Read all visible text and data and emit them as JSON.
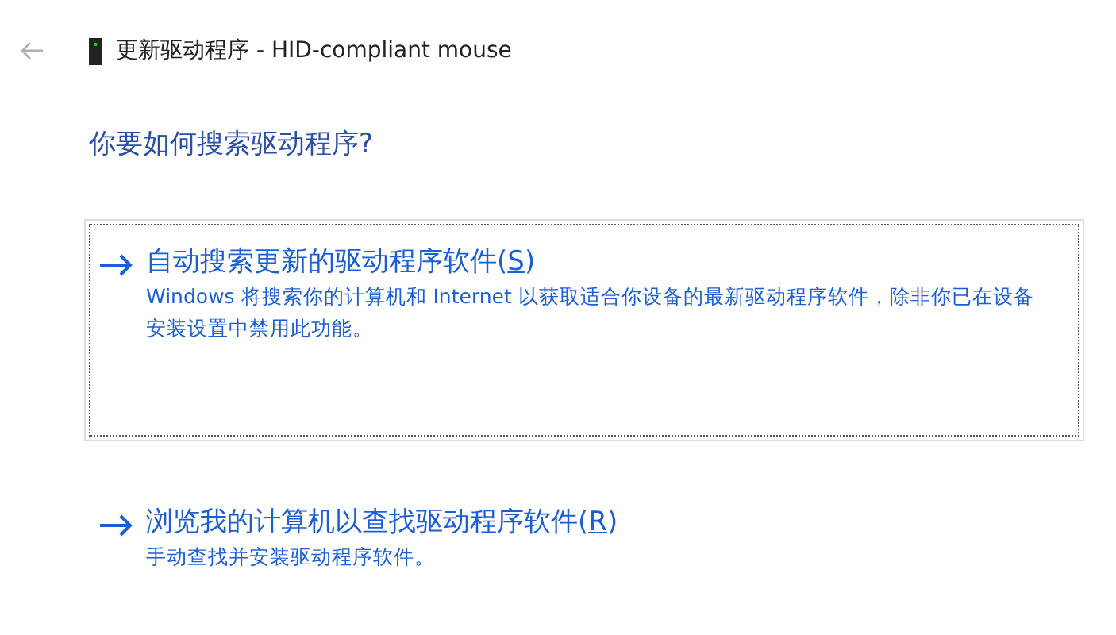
{
  "window": {
    "title": "更新驱动程序 - HID-compliant mouse"
  },
  "heading": "你要如何搜索驱动程序?",
  "options": [
    {
      "title": "自动搜索更新的驱动程序软件(",
      "access_key": "S",
      "title_end": ")",
      "description": "Windows 将搜索你的计算机和 Internet 以获取适合你设备的最新驱动程序软件，除非你已在设备安装设置中禁用此功能。",
      "focused": true
    },
    {
      "title": "浏览我的计算机以查找驱动程序软件(",
      "access_key": "R",
      "title_end": ")",
      "description": "手动查找并安装驱动程序软件。",
      "focused": false
    }
  ]
}
